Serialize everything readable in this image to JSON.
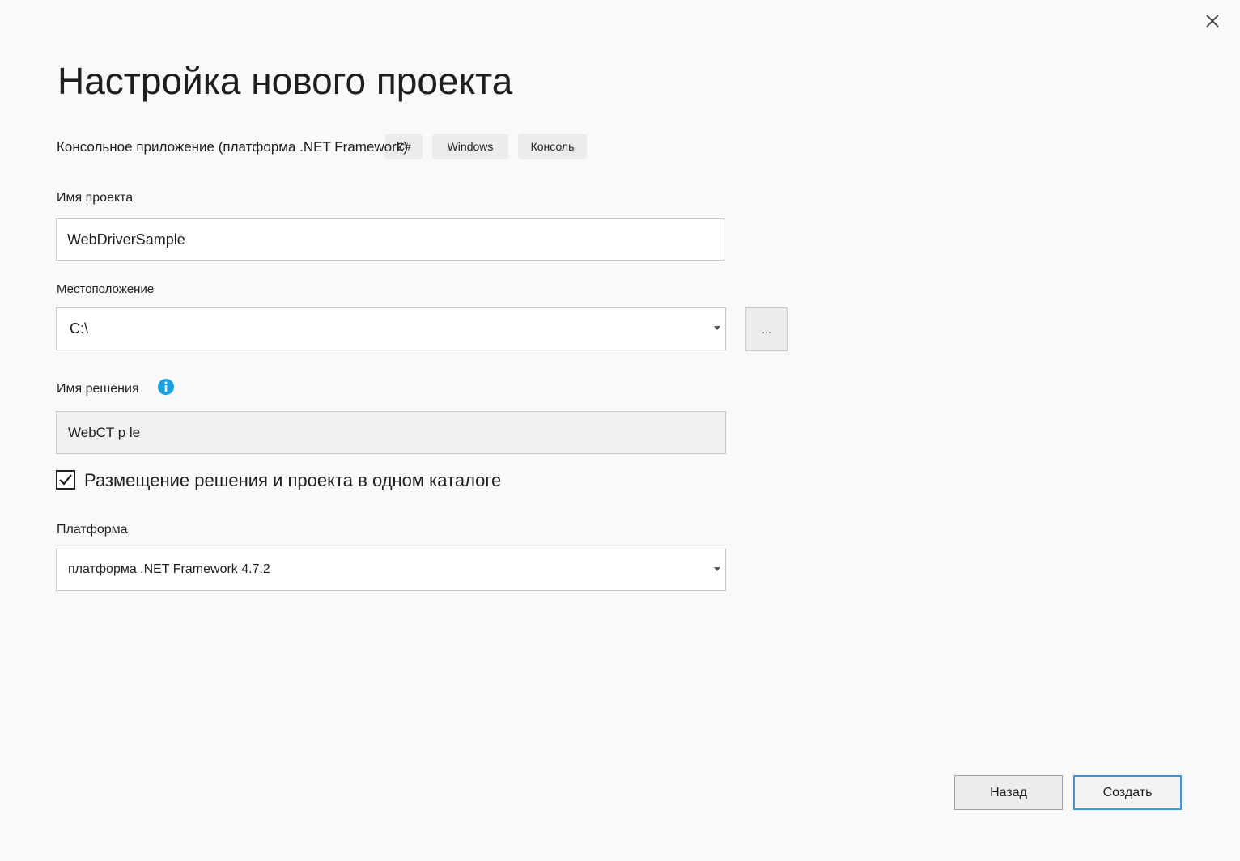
{
  "dialog": {
    "title": "Настройка нового проекта",
    "close_icon": "close-icon"
  },
  "template": {
    "name": "Консольное приложение (платформа .NET Framework)",
    "tags": [
      "C#",
      "Windows",
      "Консоль"
    ]
  },
  "project_name": {
    "label": "Имя проекта",
    "value": "WebDriverSample"
  },
  "location": {
    "label": "Местоположение",
    "value": "C:\\",
    "browse_label": "..."
  },
  "solution_name": {
    "label": "Имя решения",
    "value": "WebCT p le",
    "info_icon": "info-icon"
  },
  "same_directory": {
    "label": "Размещение решения и проекта в одном каталоге",
    "checked": true
  },
  "framework": {
    "label": "Платформа",
    "value": "платформа .NET Framework 4.7.2"
  },
  "buttons": {
    "back": "Назад",
    "create": "Создать"
  },
  "colors": {
    "background": "#f9f9f9",
    "accent": "#3a96dd",
    "info": "#1ba1e2"
  }
}
